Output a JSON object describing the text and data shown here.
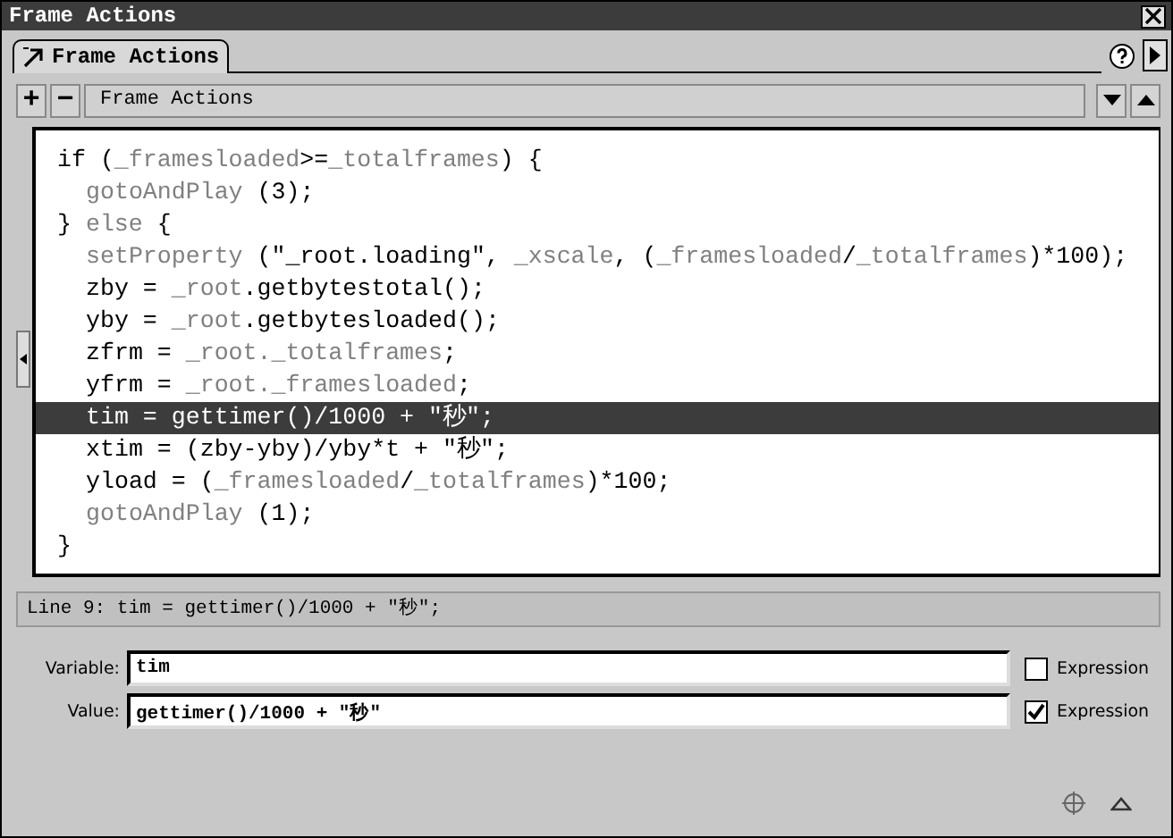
{
  "window": {
    "title": "Frame Actions"
  },
  "tabs": [
    {
      "label": "Frame Actions",
      "selected": true
    }
  ],
  "toolbar": {
    "add": "+",
    "remove": "−",
    "title": "Frame Actions"
  },
  "code": [
    {
      "selected": false,
      "tokens": [
        {
          "kind": "plain",
          "text": "if ("
        },
        {
          "kind": "keyword",
          "text": "_framesloaded"
        },
        {
          "kind": "plain",
          "text": ">="
        },
        {
          "kind": "keyword",
          "text": "_totalframes"
        },
        {
          "kind": "plain",
          "text": ") {"
        }
      ],
      "children": [
        {
          "selected": false,
          "tokens": [
            {
              "kind": "keyword",
              "text": "gotoAndPlay"
            },
            {
              "kind": "plain",
              "text": " (3);"
            }
          ]
        }
      ]
    },
    {
      "selected": false,
      "tokens": [
        {
          "kind": "plain",
          "text": "} "
        },
        {
          "kind": "keyword",
          "text": "else"
        },
        {
          "kind": "plain",
          "text": " {"
        }
      ],
      "children": [
        {
          "selected": false,
          "tokens": [
            {
              "kind": "keyword",
              "text": "setProperty"
            },
            {
              "kind": "plain",
              "text": " (\"_root.loading\", "
            },
            {
              "kind": "keyword",
              "text": "_xscale"
            },
            {
              "kind": "plain",
              "text": ", ("
            },
            {
              "kind": "keyword",
              "text": "_framesloaded"
            },
            {
              "kind": "plain",
              "text": "/"
            },
            {
              "kind": "keyword",
              "text": "_totalframes"
            },
            {
              "kind": "plain",
              "text": ")*100);"
            }
          ]
        },
        {
          "selected": false,
          "tokens": [
            {
              "kind": "plain",
              "text": "zby = "
            },
            {
              "kind": "keyword",
              "text": "_root"
            },
            {
              "kind": "plain",
              "text": ".getbytestotal();"
            }
          ]
        },
        {
          "selected": false,
          "tokens": [
            {
              "kind": "plain",
              "text": "yby = "
            },
            {
              "kind": "keyword",
              "text": "_root"
            },
            {
              "kind": "plain",
              "text": ".getbytesloaded();"
            }
          ]
        },
        {
          "selected": false,
          "tokens": [
            {
              "kind": "plain",
              "text": "zfrm = "
            },
            {
              "kind": "keyword",
              "text": "_root._totalframes"
            },
            {
              "kind": "plain",
              "text": ";"
            }
          ]
        },
        {
          "selected": false,
          "tokens": [
            {
              "kind": "plain",
              "text": "yfrm = "
            },
            {
              "kind": "keyword",
              "text": "_root._framesloaded"
            },
            {
              "kind": "plain",
              "text": ";"
            }
          ]
        },
        {
          "selected": true,
          "tokens": [
            {
              "kind": "plain",
              "text": "tim = gettimer()/1000 + \"秒\";"
            }
          ]
        },
        {
          "selected": false,
          "tokens": [
            {
              "kind": "plain",
              "text": "xtim = (zby-yby)/yby*t + \"秒\";"
            }
          ]
        },
        {
          "selected": false,
          "tokens": [
            {
              "kind": "plain",
              "text": "yload = ("
            },
            {
              "kind": "keyword",
              "text": "_framesloaded"
            },
            {
              "kind": "plain",
              "text": "/"
            },
            {
              "kind": "keyword",
              "text": "_totalframes"
            },
            {
              "kind": "plain",
              "text": ")*100;"
            }
          ]
        },
        {
          "selected": false,
          "tokens": [
            {
              "kind": "keyword",
              "text": "gotoAndPlay"
            },
            {
              "kind": "plain",
              "text": " (1);"
            }
          ]
        }
      ]
    },
    {
      "selected": false,
      "tokens": [
        {
          "kind": "plain",
          "text": "}"
        }
      ]
    }
  ],
  "status_line": "Line 9: tim = gettimer()/1000 + \"秒\";",
  "fields": [
    {
      "label": "Variable:",
      "value": "tim",
      "expression_label": "Expression",
      "checked": false
    },
    {
      "label": "Value:",
      "value": "gettimer()/1000 + \"秒\"",
      "expression_label": "Expression",
      "checked": true
    }
  ]
}
